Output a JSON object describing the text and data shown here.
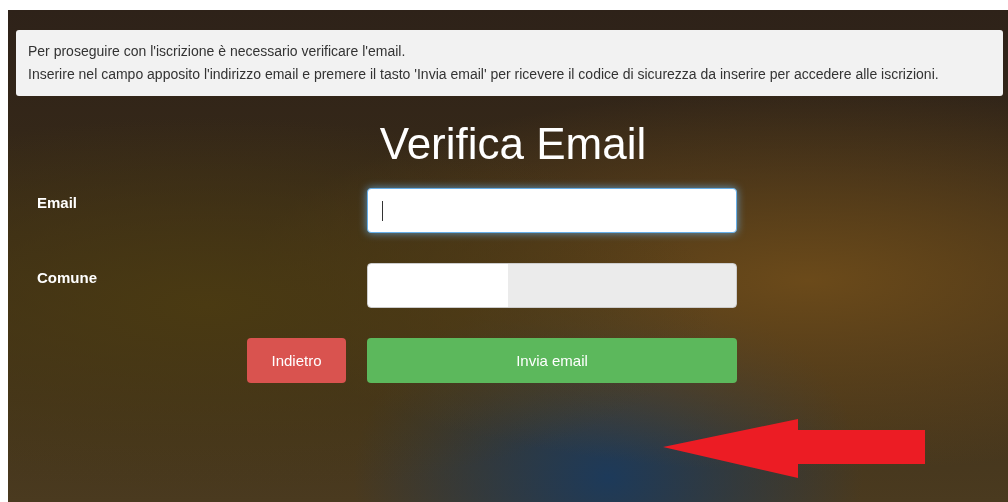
{
  "notice": {
    "paragraphs": [
      "Per proseguire con l'iscrizione è necessario verificare l'email.",
      "Inserire nel campo apposito l'indirizzo email e premere il tasto 'Invia email' per ricevere il codice di sicurezza da inserire per accedere alle iscrizioni."
    ]
  },
  "title": "Verifica Email",
  "fields": [
    {
      "label": "Email",
      "kind": "text",
      "focused": true
    },
    {
      "label": "Comune",
      "kind": "select",
      "focused": false
    }
  ],
  "buttons": [
    {
      "label": "Indietro",
      "kind": "danger"
    },
    {
      "label": "Invia email",
      "kind": "success"
    }
  ]
}
